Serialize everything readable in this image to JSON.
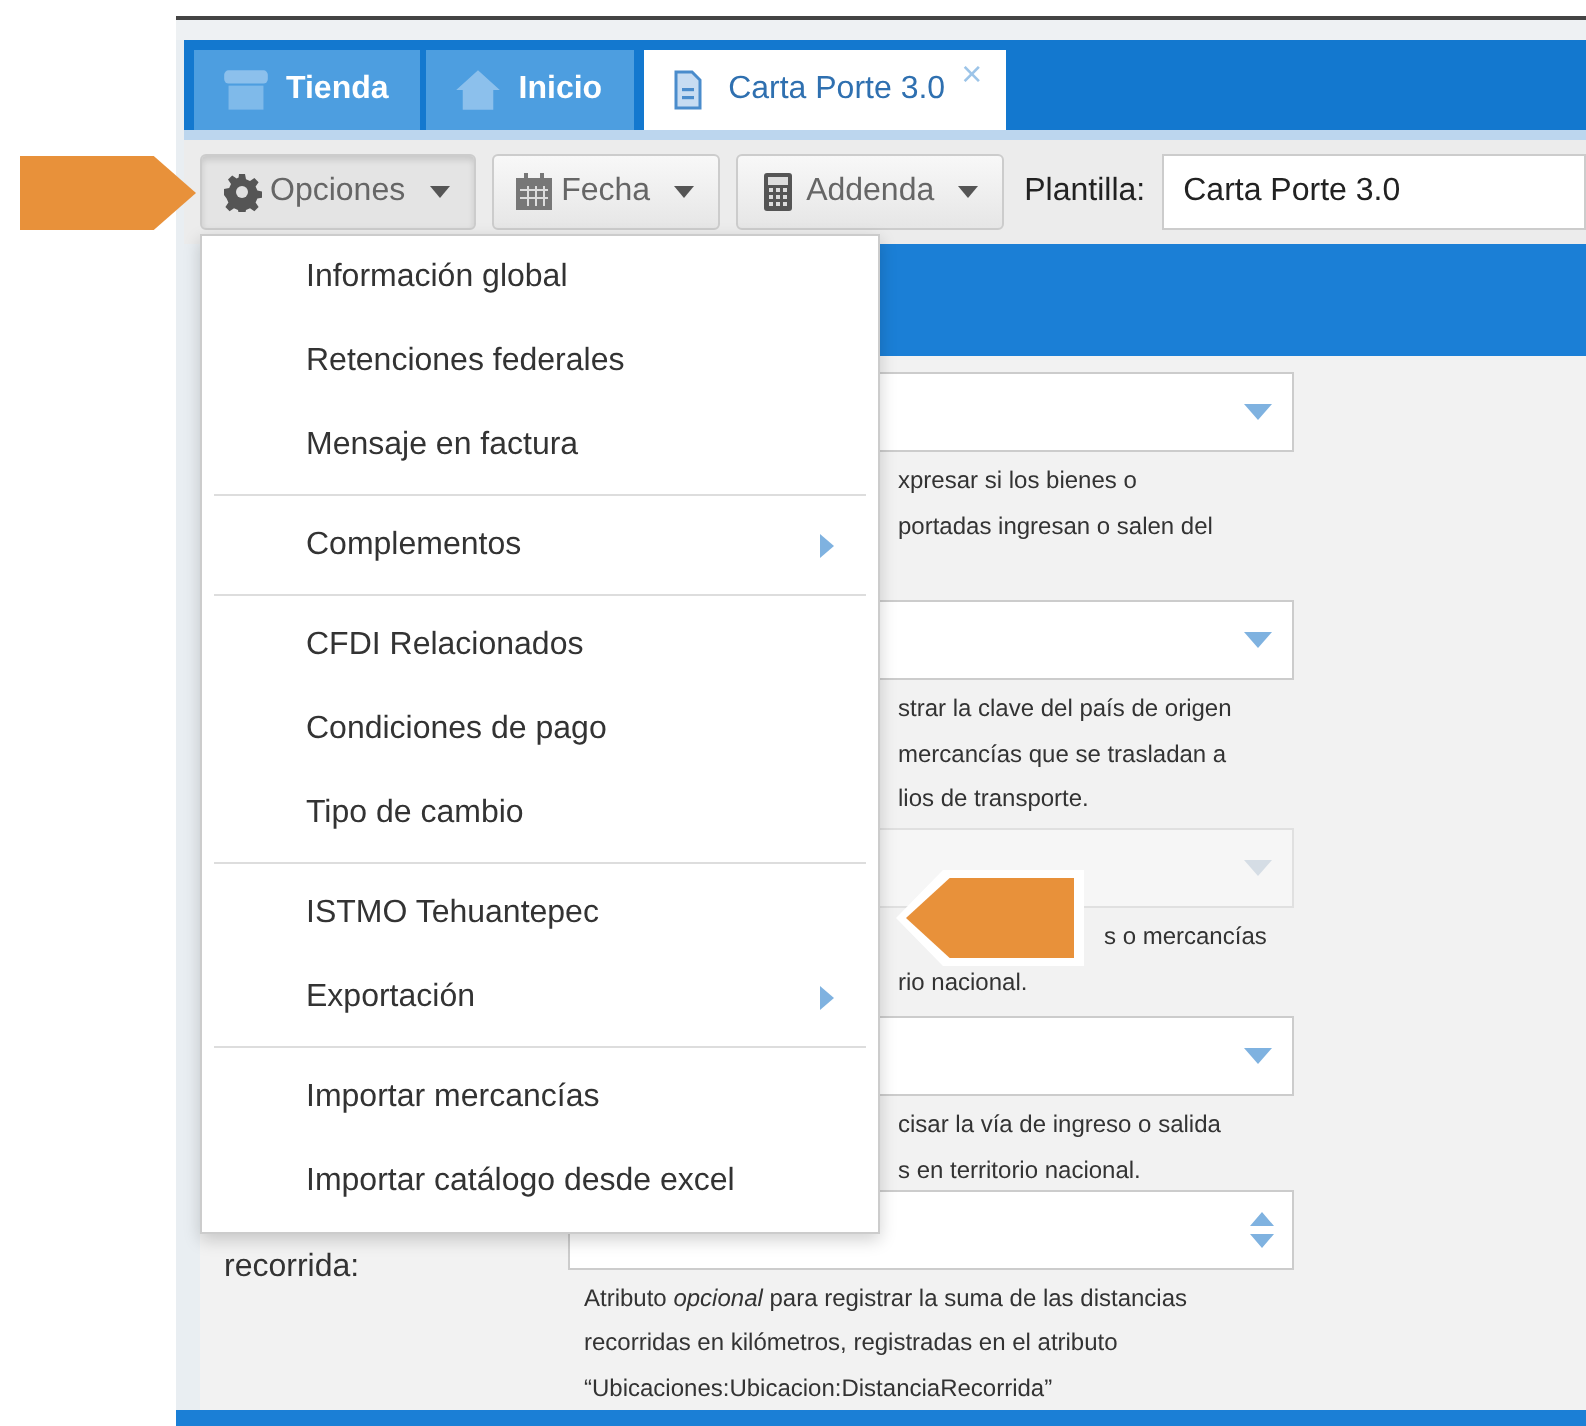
{
  "tabs": [
    {
      "label": "Tienda",
      "selected": false
    },
    {
      "label": "Inicio",
      "selected": false
    },
    {
      "label": "Carta Porte 3.0",
      "selected": true,
      "close": "×"
    }
  ],
  "toolbar": {
    "buttons": [
      {
        "label": "Opciones",
        "expanded": true
      },
      {
        "label": "Fecha",
        "expanded": false
      },
      {
        "label": "Addenda",
        "expanded": false
      }
    ],
    "template_label": "Plantilla:",
    "template_value": "Carta Porte 3.0"
  },
  "menu": {
    "expanded": true,
    "groups": [
      [
        {
          "label": "Información global",
          "submenu": false
        },
        {
          "label": "Retenciones federales",
          "submenu": false
        },
        {
          "label": "Mensaje en factura",
          "submenu": false
        }
      ],
      [
        {
          "label": "Complementos",
          "submenu": true
        }
      ],
      [
        {
          "label": "CFDI Relacionados",
          "submenu": false
        },
        {
          "label": "Condiciones de pago",
          "submenu": false
        },
        {
          "label": "Tipo de cambio",
          "submenu": false
        }
      ],
      [
        {
          "label": "ISTMO Tehuantepec",
          "submenu": false
        },
        {
          "label": "Exportación",
          "submenu": true
        }
      ],
      [
        {
          "label": "Importar mercancías",
          "submenu": false
        },
        {
          "label": "Importar catálogo desde excel",
          "submenu": false
        }
      ]
    ]
  },
  "fields": [
    {
      "kind": "dropdown",
      "disabled": false,
      "hint": [
        "xpresar si los bienes o",
        "portadas ingresan o salen del"
      ]
    },
    {
      "kind": "dropdown",
      "disabled": false,
      "hint": [
        "strar la clave del país de origen",
        "mercancías que se trasladan a",
        "lios de transporte."
      ]
    },
    {
      "kind": "dropdown",
      "disabled": true,
      "hint": [
        "s o mercancías",
        "rio nacional."
      ]
    },
    {
      "kind": "dropdown",
      "disabled": false,
      "hint": [
        "cisar la vía de ingreso o salida",
        "s en territorio nacional."
      ]
    },
    {
      "label": "recorrida:",
      "kind": "spinner",
      "disabled": false,
      "hint": [
        "Atributo *opcional* para registrar la suma de las distancias",
        "recorridas en kilómetros, registradas en el atributo",
        "“Ubicaciones:Ubicacion:DistanciaRecorrida”"
      ]
    }
  ]
}
